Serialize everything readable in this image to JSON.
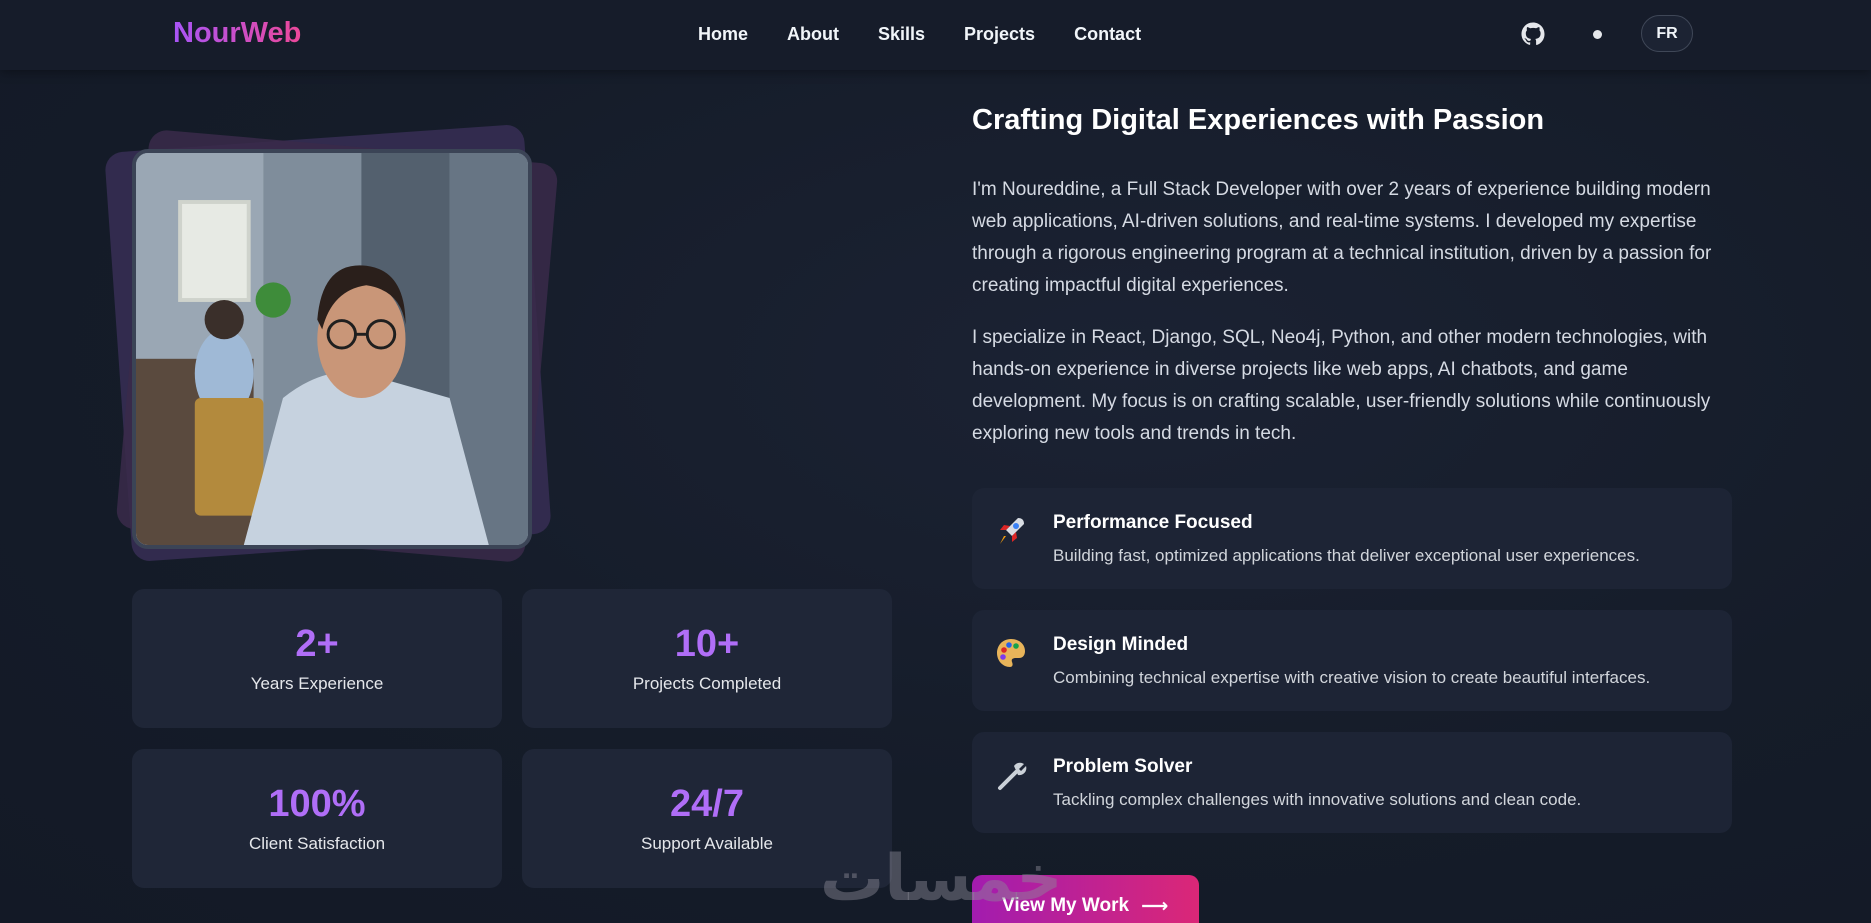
{
  "nav": {
    "logo": "NourWeb",
    "links": [
      "Home",
      "About",
      "Skills",
      "Projects",
      "Contact"
    ],
    "github_icon": "github-icon",
    "theme_toggle_icon": "dot-icon",
    "lang_button": "FR"
  },
  "about": {
    "heading": "Crafting Digital Experiences with Passion",
    "paragraphs": [
      "I'm Noureddine, a Full Stack Developer with over 2 years of experience building modern web applications, AI-driven solutions, and real-time systems. I developed my expertise through a rigorous engineering program at a technical institution, driven by a passion for creating impactful digital experiences.",
      "I specialize in React, Django, SQL, Neo4j, Python, and other modern technologies, with hands-on experience in diverse projects like web apps, AI chatbots, and game development. My focus is on crafting scalable, user-friendly solutions while continuously exploring new tools and trends in tech."
    ],
    "features": [
      {
        "icon": "rocket-icon",
        "title": "Performance Focused",
        "desc": "Building fast, optimized applications that deliver exceptional user experiences."
      },
      {
        "icon": "palette-icon",
        "title": "Design Minded",
        "desc": "Combining technical expertise with creative vision to create beautiful interfaces."
      },
      {
        "icon": "wrench-icon",
        "title": "Problem Solver",
        "desc": "Tackling complex challenges with innovative solutions and clean code."
      }
    ],
    "cta": "View My Work",
    "cta_icon": "arrow-right-icon"
  },
  "stats": [
    {
      "value": "2+",
      "label": "Years Experience"
    },
    {
      "value": "10+",
      "label": "Projects Completed"
    },
    {
      "value": "100%",
      "label": "Client Satisfaction"
    },
    {
      "value": "24/7",
      "label": "Support Available"
    }
  ],
  "watermark": "خمسات",
  "colors": {
    "accent_purple": "#b06ef7",
    "gradient_start": "#a21caf",
    "gradient_end": "#db2777",
    "background": "#151c29",
    "card": "#1f2637"
  }
}
